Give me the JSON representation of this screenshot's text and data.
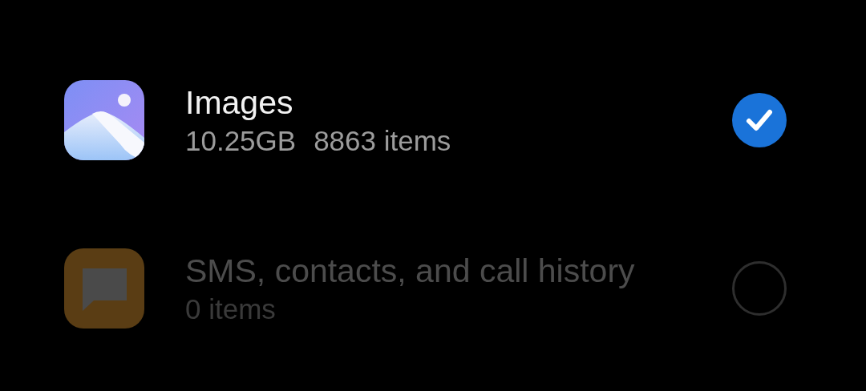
{
  "items": [
    {
      "kind": "gallery",
      "title": "Images",
      "size": "10.25GB",
      "count": "8863 items",
      "selected": true,
      "disabled": false
    },
    {
      "kind": "messages",
      "title": "SMS, contacts, and call history",
      "count": "0 items",
      "selected": false,
      "disabled": true
    }
  ]
}
